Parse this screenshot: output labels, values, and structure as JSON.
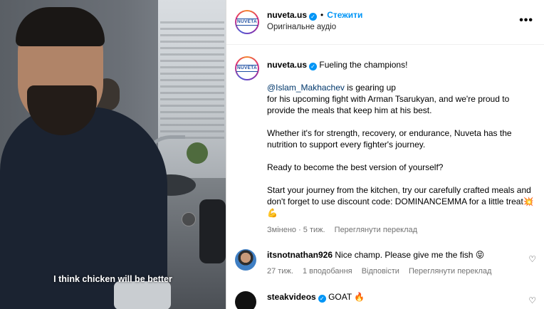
{
  "header": {
    "username": "nuveta.us",
    "follow_label": "Стежити",
    "audio_label": "Оригінальне аудіо",
    "avatar_logo": "NUVETA",
    "more_icon": "more-icon"
  },
  "video": {
    "caption": "I think chicken will be better"
  },
  "post": {
    "username": "nuveta.us",
    "headline": "Fueling the champions!",
    "mention": "@Islam_Makhachev",
    "para1_rest1": " is gearing up",
    "para1_rest2": "for his upcoming fight with Arman Tsarukyan, and we're proud to provide the meals that keep him at his best.",
    "para2": "Whether it's for strength, recovery, or endurance, Nuveta has the nutrition to support every fighter's journey.",
    "para3": "Ready to become the best version of yourself?",
    "para4": "Start your journey from the kitchen, try our carefully crafted meals and don't forget to use discount code: DOMINANCEMMA for a little treat",
    "para4_emoji": "💥💪",
    "meta_edited": "Змінено · 5 тиж.",
    "meta_translate": "Переглянути переклад"
  },
  "comments": [
    {
      "username": "itsnotnathan926",
      "text": "Nice champ. Please give me the fish",
      "emoji": "😝",
      "time": "27 тиж.",
      "likes": "1 вподобання",
      "reply": "Відповісти",
      "translate": "Переглянути переклад"
    },
    {
      "username": "steakvideos",
      "text": "GOAT",
      "emoji": "🔥"
    }
  ],
  "colors": {
    "accent": "#0095f6",
    "mention": "#00376b",
    "muted": "#737373"
  }
}
